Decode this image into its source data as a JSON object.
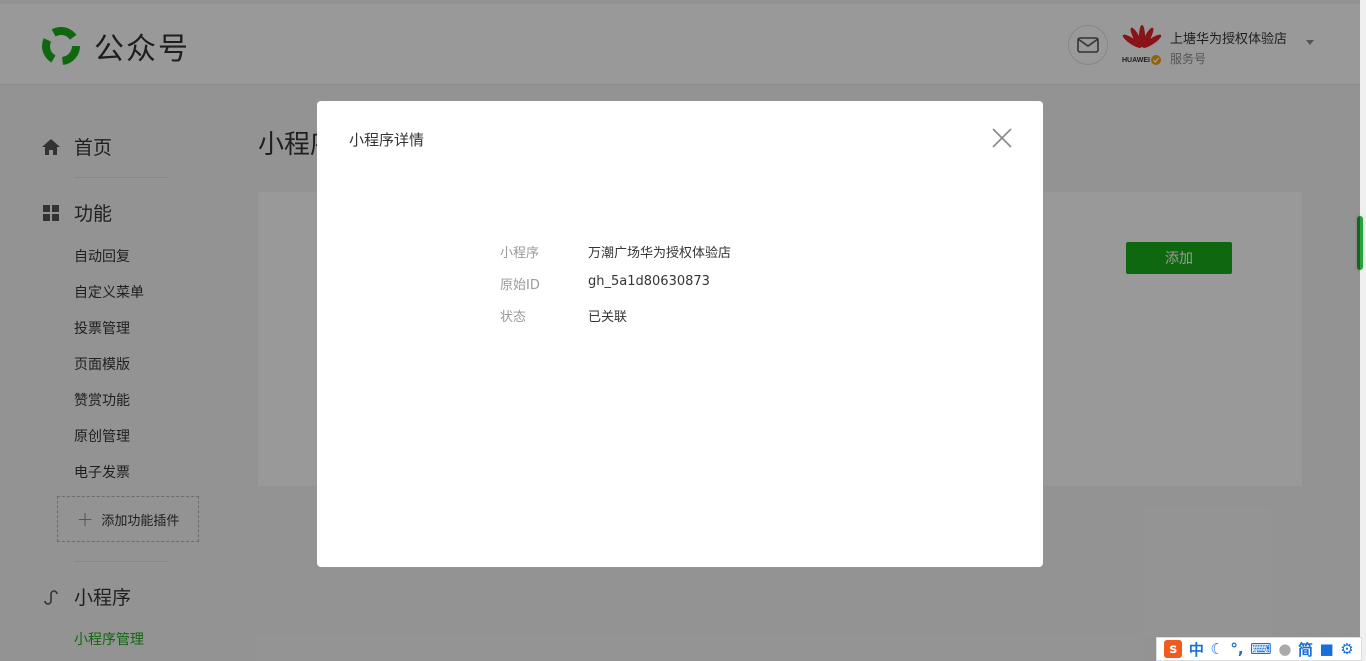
{
  "header": {
    "app_name": "公众号",
    "account_name": "上塘华为授权体验店",
    "account_type": "服务号",
    "avatar_text": "HUAWEI"
  },
  "sidebar": {
    "home": "首页",
    "features": "功能",
    "feature_items": [
      "自动回复",
      "自定义菜单",
      "投票管理",
      "页面模版",
      "赞赏功能",
      "原创管理",
      "电子发票"
    ],
    "add_plugin": "添加功能插件",
    "mini_program": "小程序",
    "mini_program_items": [
      "小程序管理"
    ]
  },
  "main": {
    "title": "小程序管理",
    "add_button": "添加"
  },
  "dialog": {
    "title": "小程序详情",
    "rows": [
      {
        "label": "小程序",
        "value": "万潮广场华为授权体验店"
      },
      {
        "label": "原始ID",
        "value": "gh_5a1d80630873"
      },
      {
        "label": "状态",
        "value": "已关联"
      }
    ]
  },
  "ime": {
    "logo": "s",
    "mode": "中",
    "simplified": "简"
  },
  "colors": {
    "brand_green": "#1aad19",
    "overlay": "rgba(0,0,0,0.4)"
  }
}
